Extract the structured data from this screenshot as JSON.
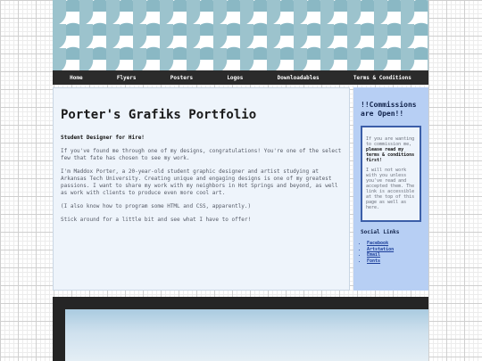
{
  "nav": {
    "items": [
      "Home",
      "Flyers",
      "Posters",
      "Logos",
      "Downloadables",
      "Terms & Conditions"
    ]
  },
  "main": {
    "title": "Porter's Grafiks Portfolio",
    "subtitle": "Student Designer for Hire!",
    "paragraphs": [
      "If you've found me through one of my designs, congratulations! You're one of the select few that fate has chosen to see my work.",
      "I'm Maddox Porter, a 20-year-old student graphic designer and artist studying at Arkansas Tech University. Creating unique and engaging designs is one of my greatest passions. I want to share my work with my neighbors in Hot Springs and beyond, as well as work with clients to produce even more cool art.",
      "(I also know how to program some HTML and CSS, apparently.)",
      "Stick around for a little bit and see what I have to offer!"
    ]
  },
  "sidebar": {
    "heading": "!!Commissions are Open!!",
    "notice_intro": "If you are wanting to commission me, ",
    "notice_bold": "please read my terms & conditions first!",
    "notice_body": "I will not work with you unless you've read and accepted them. The link is accessible at the top of this page as well as here.",
    "links_title": "Social Links",
    "links": [
      "Facebook",
      "Artstation",
      "Email",
      "Fonts"
    ]
  },
  "colors": {
    "nav_bg": "#2b2b2b",
    "banner_accent": "#9cc3cd",
    "sidebar_bg": "#b7cff4",
    "link": "#1d3f9a"
  }
}
